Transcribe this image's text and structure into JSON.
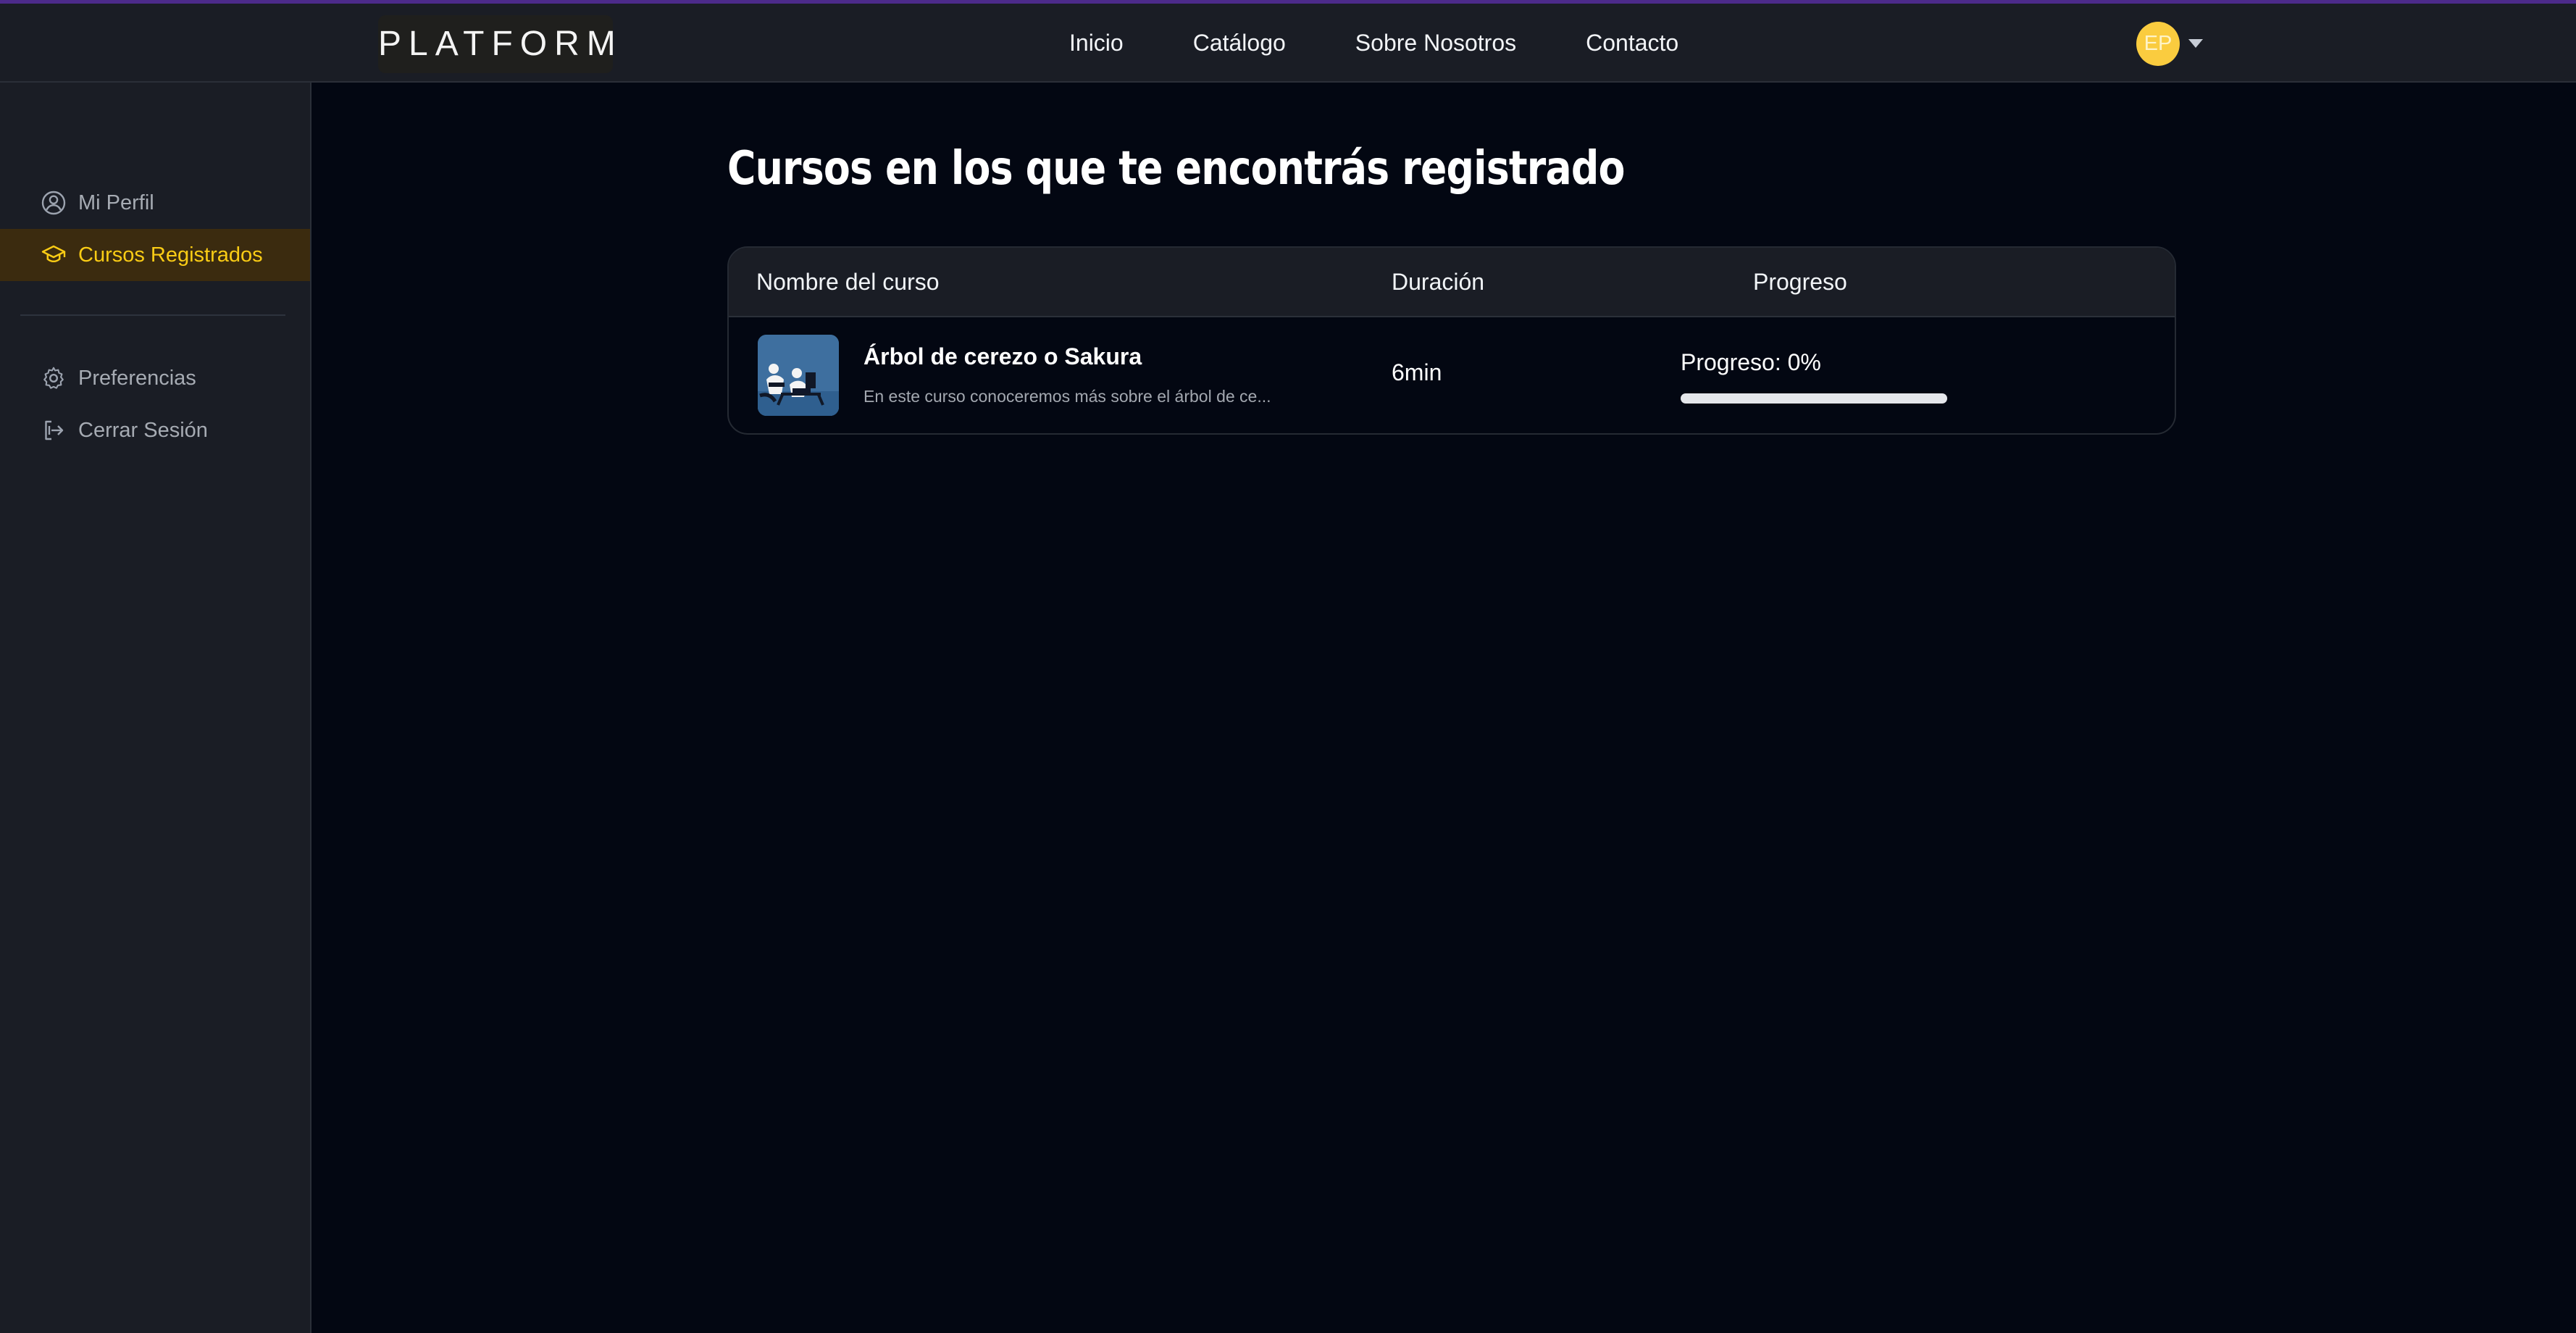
{
  "brand": {
    "label": "PLATFORM"
  },
  "nav": {
    "items": [
      {
        "label": "Inicio"
      },
      {
        "label": "Catálogo"
      },
      {
        "label": "Sobre Nosotros"
      },
      {
        "label": "Contacto"
      }
    ]
  },
  "user": {
    "initials": "EP",
    "menu_icon": "chevron-down-icon"
  },
  "sidebar": {
    "items": [
      {
        "label": "Mi Perfil",
        "icon": "user-circle-icon",
        "active": false
      },
      {
        "label": "Cursos Registrados",
        "icon": "graduation-cap-icon",
        "active": true
      },
      {
        "label": "Preferencias",
        "icon": "gear-icon",
        "active": false
      },
      {
        "label": "Cerrar Sesión",
        "icon": "logout-icon",
        "active": false
      }
    ]
  },
  "page": {
    "title": "Cursos en los que te encontrás registrado"
  },
  "courses": {
    "columns": [
      "Nombre del curso",
      "Duración",
      "Progreso"
    ],
    "rows": [
      {
        "title": "Árbol de cerezo o Sakura",
        "description": "En este curso conoceremos más sobre el árbol de ce...",
        "duration": "6min",
        "progress_label": "Progreso: 0%",
        "progress_percent": 0
      }
    ]
  },
  "colors": {
    "accent": "#facc15",
    "background": "#030712",
    "surface": "#1a1d25",
    "muted_text": "#a6abb3"
  }
}
